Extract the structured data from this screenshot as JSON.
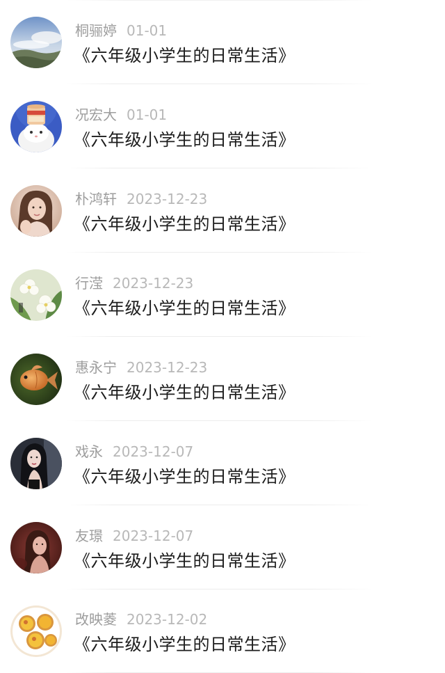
{
  "posts": [
    {
      "name": "桐骊婷",
      "date": "01-01",
      "title": "《六年级小学生的日常生活》",
      "avatar": "landscape-sky-avatar"
    },
    {
      "name": "况宏大",
      "date": "01-01",
      "title": "《六年级小学生的日常生活》",
      "avatar": "white-cat-avatar"
    },
    {
      "name": "朴鸿轩",
      "date": "2023-12-23",
      "title": "《六年级小学生的日常生活》",
      "avatar": "girl-portrait-avatar"
    },
    {
      "name": "行滢",
      "date": "2023-12-23",
      "title": "《六年级小学生的日常生活》",
      "avatar": "white-flowers-avatar"
    },
    {
      "name": "惠永宁",
      "date": "2023-12-23",
      "title": "《六年级小学生的日常生活》",
      "avatar": "goldfish-avatar"
    },
    {
      "name": "戏永",
      "date": "2023-12-07",
      "title": "《六年级小学生的日常生活》",
      "avatar": "dark-portrait-avatar"
    },
    {
      "name": "友璟",
      "date": "2023-12-07",
      "title": "《六年级小学生的日常生活》",
      "avatar": "red-portrait-avatar"
    },
    {
      "name": "改映菱",
      "date": "2023-12-02",
      "title": "《六年级小学生的日常生活》",
      "avatar": "egg-tarts-avatar"
    }
  ]
}
